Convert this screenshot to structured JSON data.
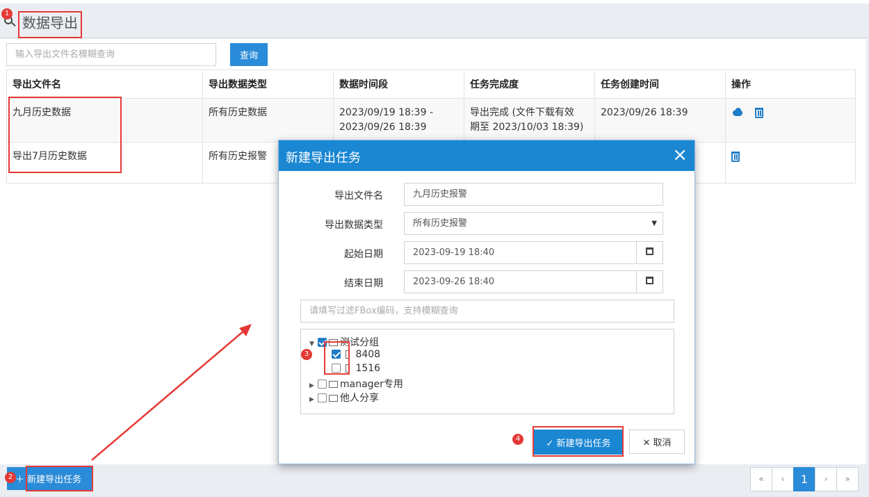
{
  "page": {
    "title": "数据导出"
  },
  "search": {
    "placeholder": "输入导出文件名模糊查询",
    "button": "查询"
  },
  "table": {
    "headers": [
      "导出文件名",
      "导出数据类型",
      "数据时间段",
      "任务完成度",
      "任务创建时间",
      "操作"
    ],
    "rows": [
      {
        "name": "九月历史数据",
        "type": "所有历史数据",
        "range_start": "2023/09/19 18:39 -",
        "range_end": "2023/09/26 18:39",
        "status_1": "导出完成 (文件下载有效",
        "status_2": "期至 2023/10/03 18:39)",
        "created": "2023/09/26 18:39"
      },
      {
        "name": "导出7月历史数据",
        "type": "所有历史报警",
        "range_start": "",
        "range_end": "",
        "status_1": "",
        "status_2": "",
        "created": ""
      }
    ]
  },
  "footer": {
    "new_task_button": "新建导出任务",
    "pager": [
      "«",
      "‹",
      "1",
      "›",
      "»"
    ]
  },
  "annotations": [
    "1",
    "2",
    "3",
    "4"
  ],
  "modal": {
    "title": "新建导出任务",
    "close": "×",
    "fields": {
      "file_name": {
        "label": "导出文件名",
        "value": "九月历史报警"
      },
      "data_type": {
        "label": "导出数据类型",
        "value": "所有历史报警"
      },
      "start_date": {
        "label": "起始日期",
        "value": "2023-09-19 18:40"
      },
      "end_date": {
        "label": "结束日期",
        "value": "2023-09-26 18:40"
      }
    },
    "filter_placeholder": "请填写过滤FBox编码，支持模糊查询",
    "tree": {
      "group": "测试分组",
      "devices": [
        "8408",
        "1516"
      ],
      "other_groups": [
        "manager专用",
        "他人分享"
      ]
    },
    "confirm": "新建导出任务",
    "cancel": "取消"
  },
  "icons": [
    "search-icon",
    "cloud-download-icon",
    "trash-icon",
    "calendar-icon",
    "folder-icon",
    "check-icon",
    "plus-icon",
    "close-icon"
  ],
  "colors": {
    "primary": "#2a8bd8",
    "annotation": "#e53935",
    "header_bg": "#eaeef3"
  }
}
